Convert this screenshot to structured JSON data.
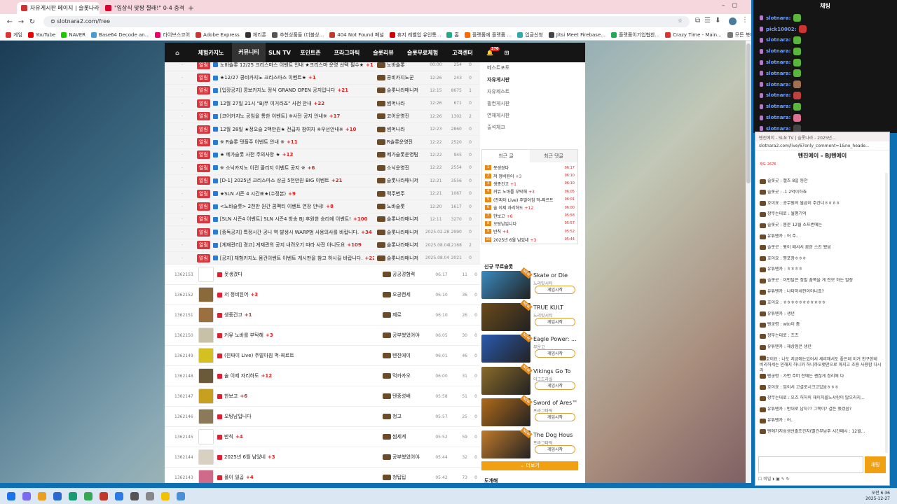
{
  "browser": {
    "tabs": [
      {
        "label": "자유게시판 페이지 | 슬롯나라",
        "active": true
      },
      {
        "label": "\"입상식 맞짱 짤래!\" 0-4 충격의..."
      }
    ],
    "new_tab": "+",
    "url": "slotnara2.com/free",
    "bookmarks": [
      "게임",
      "YouTube",
      "NAVER",
      "Base64 Decode an...",
      "라이브스코어",
      "Adobe Express",
      "체리폰",
      "추천상품들 (더블상...",
      "404 Not Found 페널",
      "휴지 레벨업 유인통...",
      "홈",
      "플랫폼에 플랫폼 ...",
      "입금신청",
      "Jitsi Meet Firebase...",
      "플랫폼이기업협찬...",
      "Crazy Time - Main...",
      "모든 북마크"
    ]
  },
  "site": {
    "nav": [
      "체험카지노",
      "커뮤니티",
      "SLN TV",
      "포인트존",
      "프라그마틱",
      "슬롯리뷰",
      "슬롯무료체험",
      "고객센터"
    ],
    "nav_active": 1,
    "notification_count": "370",
    "notice_badge": "알림",
    "notices": [
      {
        "title": "노바슬롯 12/25 크리스마스 이벤트 안내 ★크리스마 운영 선택 필수★",
        "count": "+1",
        "author": "노바슬롯",
        "time": "00:00",
        "views": "254",
        "likes": "0"
      },
      {
        "title": "★12/27 콩비카지노 크리스마스 이벤트★",
        "count": "+1",
        "author": "콩비카지노꾼",
        "time": "12:26",
        "views": "243",
        "likes": "0"
      },
      {
        "title": "[입장공지] 콩보카지노 정식 GRAND OPEN 공지입니다",
        "count": "+21",
        "author": "슬롯나라매니저",
        "time": "12:15",
        "views": "8675",
        "likes": "1"
      },
      {
        "title": "12월 27일 21시 \"BJ무 이거라죠\" 사전 안내",
        "count": "+22",
        "author": "썸머나라",
        "time": "12:26",
        "views": "671",
        "likes": "0"
      },
      {
        "title": "[코어카지노 공임을 통한 이벤트] ※사전 공지 안내※",
        "count": "+17",
        "author": "코어운영진",
        "time": "12:26",
        "views": "1302",
        "likes": "2"
      },
      {
        "title": "12월 28일 ★정오슬 2백만원★ 전급자 참여자 ※우선안내※",
        "count": "+10",
        "author": "썸머나라",
        "time": "12:23",
        "views": "2860",
        "likes": "0"
      },
      {
        "title": "※ R슬롯 텟플주 이벤트 안내 ※",
        "count": "+11",
        "author": "R슬롯운영진",
        "time": "12:22",
        "views": "2520",
        "likes": "0"
      },
      {
        "title": "★ 메가슬롯 사전 주의사항 ★",
        "count": "+13",
        "author": "메가슬롯운영팀",
        "time": "12:22",
        "views": "945",
        "likes": "0"
      },
      {
        "title": "※ 소닉카지노 이전 콜리지 이벤트 공지 ※",
        "count": "+6",
        "author": "소닉운영진",
        "time": "12:22",
        "views": "2554",
        "likes": "0"
      },
      {
        "title": "[D-1] 2025년 크리스마스 상금 5천만원 BIG 이벤트",
        "count": "+21",
        "author": "슬롯나라매니저",
        "time": "12:21",
        "views": "3556",
        "likes": "0"
      },
      {
        "title": "★SLN 시즌 4 시간표★(수정본)",
        "count": "+9",
        "author": "맥주변주",
        "time": "12:21",
        "views": "1067",
        "likes": "0"
      },
      {
        "title": "<노바슬롯> 2천만 원간 콤팩티 이벤트 연장 안내!",
        "count": "+8",
        "author": "노바슬롯",
        "time": "12:20",
        "views": "1617",
        "likes": "0"
      },
      {
        "title": "[SLN 시즌4 이벤트] SLN 시즌4 방송 BJ 후원한 승리에 이벤트!",
        "count": "+100",
        "author": "슬롯나라매니저",
        "time": "12:11",
        "views": "3270",
        "likes": "0"
      },
      {
        "title": "[중독공지] 특정시간 공니 역 발생시 WARP범 사용의사를 바랍니다.",
        "count": "+34",
        "author": "슬롯나라매니저",
        "time": "2025.02.28",
        "views": "2990",
        "likes": "0"
      },
      {
        "title": "[게재관리] 경고] 게재관의 공지 내려오기 따라 사전 아니도요",
        "count": "+109",
        "author": "슬롯나라매니저",
        "time": "2025.08.04",
        "views": "12168",
        "likes": "2"
      },
      {
        "title": "[공지] 체험카지노 몸건이벤트 이벤트 게시판을 참고 하시길 바랍니다.",
        "count": "+22",
        "author": "슬롯나라매니저",
        "time": "2025.08.04",
        "views": "2021",
        "likes": "0"
      }
    ],
    "posts": [
      {
        "num": "1362153",
        "title": "못생겼다",
        "count": "",
        "author": "공공경험력",
        "time": "06:17",
        "views": "11",
        "likes": "0",
        "thumb": "#ffffff"
      },
      {
        "num": "1362152",
        "title": "저 정비된어",
        "count": "+3",
        "author": "오공캔세",
        "time": "06:10",
        "views": "36",
        "likes": "0",
        "thumb": "#8a6a3a"
      },
      {
        "num": "1362151",
        "title": "생종건고",
        "count": "+1",
        "author": "제로",
        "time": "06:10",
        "views": "26",
        "likes": "0",
        "thumb": "#9a7040"
      },
      {
        "num": "1362150",
        "title": "커뮤 노바를 부탁해",
        "count": "+3",
        "author": "공부했었어야",
        "time": "06:05",
        "views": "30",
        "likes": "0",
        "thumb": "#c9c0a8"
      },
      {
        "num": "1362149",
        "title": "(진짜이 Live) 주말아침 먹-찌르트",
        "count": "",
        "author": "텐진에이",
        "time": "06:01",
        "views": "46",
        "likes": "0",
        "thumb": "#d4c020"
      },
      {
        "num": "1362148",
        "title": "술 이제 자리하도",
        "count": "+12",
        "author": "먹카카오",
        "time": "06:00",
        "views": "31",
        "likes": "0",
        "thumb": "#6b5a3a"
      },
      {
        "num": "1362147",
        "title": "한보고",
        "count": "+6",
        "author": "텐중성배",
        "time": "05:58",
        "views": "51",
        "likes": "0",
        "thumb": "#c8a020"
      },
      {
        "num": "1362146",
        "title": "오팅남입니다",
        "count": "",
        "author": "청고",
        "time": "05:57",
        "views": "25",
        "likes": "0",
        "thumb": "#8a7a5a"
      },
      {
        "num": "1362145",
        "title": "반칙",
        "count": "+4",
        "author": "썸세계",
        "time": "05:52",
        "views": "59",
        "likes": "0",
        "thumb": "#ffffff"
      },
      {
        "num": "1362144",
        "title": "2025년 6월 남었네",
        "count": "+3",
        "author": "공부했었어야",
        "time": "05:44",
        "views": "32",
        "likes": "0",
        "thumb": "#d8d0c0"
      },
      {
        "num": "1362143",
        "title": "풀이 일곱",
        "count": "+4",
        "author": "청팁팁",
        "time": "05:42",
        "views": "73",
        "likes": "0",
        "thumb": "#d06a8a"
      }
    ],
    "side_menu": [
      "베스트포토",
      "자유게시판",
      "자유제스트",
      "필컨게시판",
      "연재게시판",
      "출석체크"
    ],
    "side_menu_active": 1,
    "recent_tabs": [
      "최근 글",
      "최근 댓글"
    ],
    "recent": [
      {
        "title": "못생겼다",
        "count": "",
        "time": "06:17"
      },
      {
        "title": "저 정비된어",
        "count": "+3",
        "time": "06:10"
      },
      {
        "title": "생종건고",
        "count": "+1",
        "time": "06:10"
      },
      {
        "title": "커뮤 노바를 부탁해",
        "count": "+3",
        "time": "06:05"
      },
      {
        "title": "(진짜이 Live) 주말아침 먹-찌르트",
        "count": "",
        "time": "06:01"
      },
      {
        "title": "술 이제 자리하도",
        "count": "+12",
        "time": "06:00"
      },
      {
        "title": "한보고",
        "count": "+6",
        "time": "05:58"
      },
      {
        "title": "오팅남입니다",
        "count": "",
        "time": "05:57"
      },
      {
        "title": "반칙",
        "count": "+4",
        "time": "05:52"
      },
      {
        "title": "2025년 6월 남었네",
        "count": "+3",
        "time": "05:44"
      }
    ],
    "new_games_title": "신규 무료슬롯",
    "games": [
      {
        "name": "Skate or Die",
        "maker": "노리밋시티",
        "btn": "게임시작",
        "color": "#3a8ac0"
      },
      {
        "name": "TRUE KULT",
        "maker": "노리밋시티",
        "btn": "게임시작",
        "color": "#6a4a1a"
      },
      {
        "name": "Eagle Power: ...",
        "maker": "부운고",
        "btn": "게임시작",
        "color": "#2a5ab0"
      },
      {
        "name": "Vikings Go To",
        "maker": "이그드라실",
        "btn": "게임시작",
        "color": "#8a6a2a"
      },
      {
        "name": "Sword of Ares™",
        "maker": "프라그마틱",
        "btn": "게임시작",
        "color": "#b06a1a"
      },
      {
        "name": "The Dog Hous",
        "maker": "프라그마틱",
        "btn": "게임시작",
        "color": "#c07a2a"
      }
    ],
    "new_tag": "NEW",
    "more_label": "더보기",
    "recent_comments_title": "도개해",
    "coin_value": "570"
  },
  "chat": {
    "title": "채팅",
    "lines": [
      {
        "name": "slotnara:",
        "emote": "#5bb53b"
      },
      {
        "name": "pick10002:",
        "emote": "#c33"
      },
      {
        "name": "slotnara:",
        "emote": "#5bb53b"
      },
      {
        "name": "slotnara:",
        "emote": "#5bb53b"
      },
      {
        "name": "slotnara:",
        "emote": "#5bb53b"
      },
      {
        "name": "slotnara:",
        "emote": "#5bb53b"
      },
      {
        "name": "slotnara:",
        "emote": "#a07050"
      },
      {
        "name": "slotnara:",
        "emote": "#c04040"
      },
      {
        "name": "slotnara:",
        "emote": "#5bb53b"
      },
      {
        "name": "slotnara:",
        "emote": "#e07090"
      },
      {
        "name": "slotnara:",
        "emote": "#444"
      }
    ]
  },
  "popup": {
    "title": "텐진에이 - SLN TV | 슬롯나라 - 2025년...",
    "url": "slotnara2.com/live/67only_comment=1&no_heade...",
    "heading": "텐진에이 - BJ텐에이",
    "viewer_count": "재도 2676",
    "messages": [
      "슬롯굿 : 젤츠 8일 동안",
      "슬롯굿 : -1 2억이하죠",
      "호이요 : 공무원의 월급이 주간너ㅎㅎㅎㅎ",
      "장무는대로 : 월평기억",
      "슬롯굿 : 몸문 12월 소프번에는",
      "유튜텐카 : 어 주..",
      "슬롯굿 : 뭥이 때서서 꿈한 스킨 됐음",
      "호이요 : 평포장ㅎㅎㅎ",
      "유튜텐카 : ㅎㅎㅎㅎ",
      "슬롯굿 : 이번달은 정말 꿈쪽을 게 전모 하는 말장",
      "유튜텐카 : 나타허세전이아니죠?",
      "호이요 : ㅎㅎㅎㅎㅎㅎㅎㅎㅎㅎㅎ",
      "유튜텐카 : 생년",
      "텐궁령 : wto이 좀",
      "장무는대로 : 츠츠",
      "유튜텐카 : 재상점은 생년",
      "호이요 : 나도 지금에는있어서 세리해서도 좋은데 이거 친구한테 비리허세는 인해지 하니까 하니까오랫만으로 마지고 조용 사용함 다시라",
      "텐궁령 : 가변 주머 전에는 괜찮게 정리해 다",
      "호이요 : 엄이서 고결로시크고있음ㅎㅎㅎ",
      "장무는대로 : 오즈 허허의 재이치를노샤랑이 많으라지...",
      "유튜텐카 : 반대로 납자?? 그쪽이? 결든 했겠음?",
      "유튜텐카 : 어..",
      "텐에가지성생선출조건지(별건부남주 시간때시 : 12월..."
    ],
    "send_label": "채팅",
    "footer": "비밀"
  },
  "taskbar": {
    "time": "오전 6:36",
    "date": "2025-12-27"
  }
}
